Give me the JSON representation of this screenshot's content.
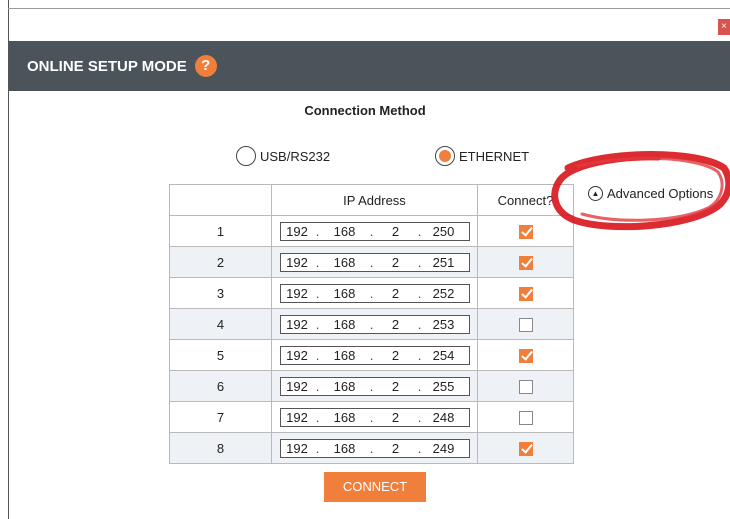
{
  "window": {
    "close_label": "×"
  },
  "header": {
    "title": "ONLINE SETUP MODE",
    "help_glyph": "?"
  },
  "connection": {
    "title": "Connection Method",
    "options": [
      {
        "label": "USB/RS232",
        "selected": false
      },
      {
        "label": "ETHERNET",
        "selected": true
      }
    ]
  },
  "table": {
    "headers": [
      "",
      "IP Address",
      "Connect?"
    ],
    "rows": [
      {
        "index": "1",
        "ip": [
          "192",
          "168",
          "2",
          "250"
        ],
        "connect": true
      },
      {
        "index": "2",
        "ip": [
          "192",
          "168",
          "2",
          "251"
        ],
        "connect": true
      },
      {
        "index": "3",
        "ip": [
          "192",
          "168",
          "2",
          "252"
        ],
        "connect": true
      },
      {
        "index": "4",
        "ip": [
          "192",
          "168",
          "2",
          "253"
        ],
        "connect": false
      },
      {
        "index": "5",
        "ip": [
          "192",
          "168",
          "2",
          "254"
        ],
        "connect": true
      },
      {
        "index": "6",
        "ip": [
          "192",
          "168",
          "2",
          "255"
        ],
        "connect": false
      },
      {
        "index": "7",
        "ip": [
          "192",
          "168",
          "2",
          "248"
        ],
        "connect": false
      },
      {
        "index": "8",
        "ip": [
          "192",
          "168",
          "2",
          "249"
        ],
        "connect": true
      }
    ]
  },
  "advanced": {
    "label": "Advanced Options",
    "icon": "chevron-up-circle-icon"
  },
  "actions": {
    "connect_label": "CONNECT"
  },
  "colors": {
    "accent": "#f07f3c",
    "header_bg": "#4a545a",
    "annotation": "#d8141b"
  }
}
